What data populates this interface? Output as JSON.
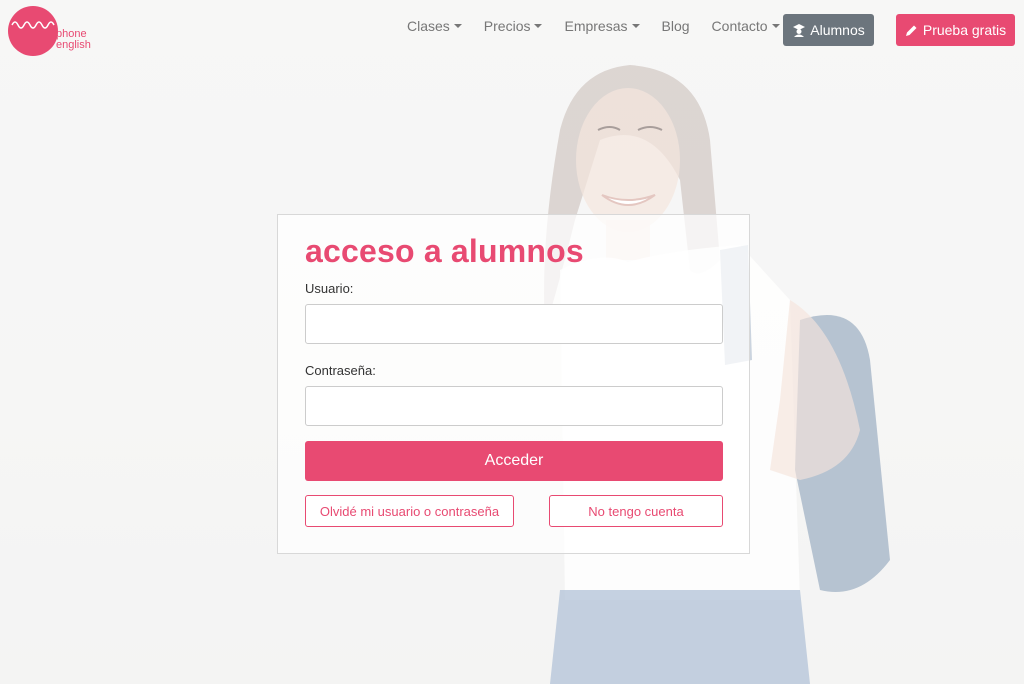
{
  "brand": {
    "logo_line1": "phone",
    "logo_line2": "english",
    "accent": "#e84a72"
  },
  "nav": {
    "items": [
      {
        "label": "Clases",
        "dropdown": true
      },
      {
        "label": "Precios",
        "dropdown": true
      },
      {
        "label": "Empresas",
        "dropdown": true
      },
      {
        "label": "Blog",
        "dropdown": false
      },
      {
        "label": "Contacto",
        "dropdown": true
      }
    ],
    "alumnos_label": "Alumnos",
    "alumnos_icon": "graduate-icon",
    "prueba_label": "Prueba gratis",
    "prueba_icon": "pencil-icon"
  },
  "login": {
    "title": "acceso a alumnos",
    "user_label": "Usuario:",
    "user_value": "",
    "password_label": "Contraseña:",
    "password_value": "",
    "submit_label": "Acceder",
    "forgot_label": "Olvidé mi usuario o contraseña",
    "no_account_label": "No tengo cuenta"
  }
}
